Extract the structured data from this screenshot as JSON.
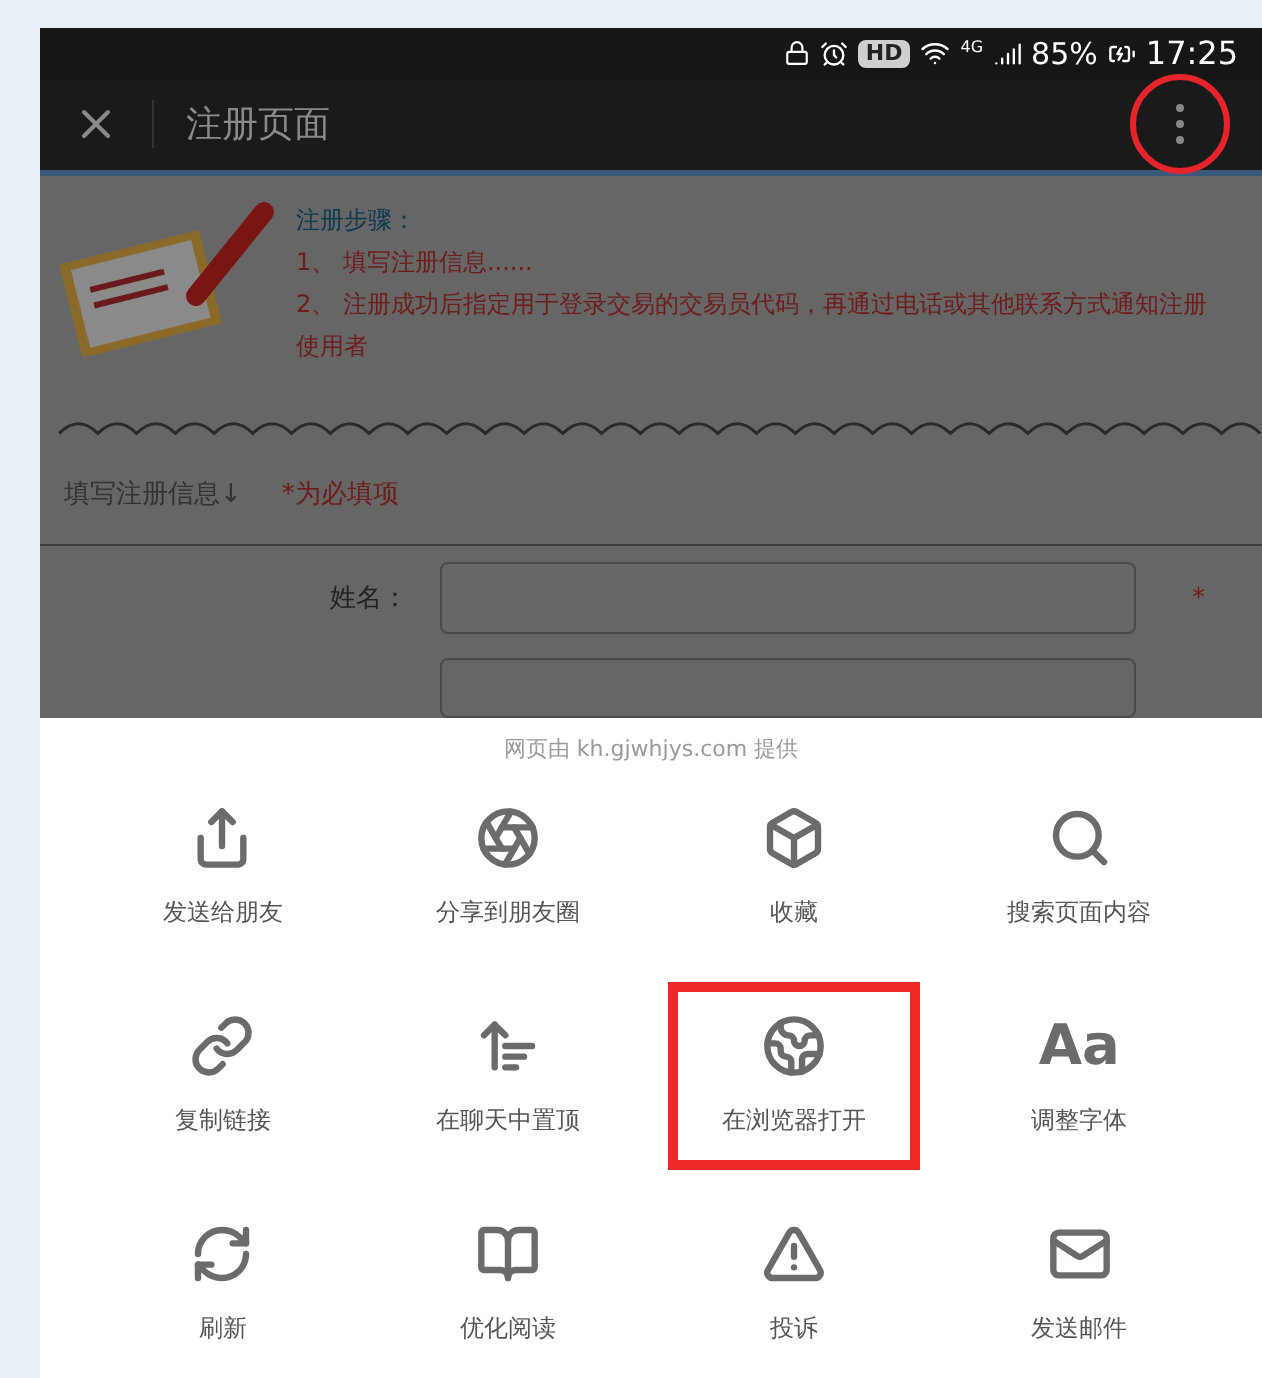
{
  "status_bar": {
    "hd": "HD",
    "network": "4G",
    "battery": "85%",
    "time": "17:25"
  },
  "title_bar": {
    "title": "注册页面",
    "menu_button": {
      "highlighted": true
    }
  },
  "page": {
    "steps_title": "注册步骤：",
    "steps": [
      "1、 填写注册信息......",
      "2、 注册成功后指定用于登录交易的交易员代码，再通过电话或其他联系方式通知注册使用者"
    ],
    "section_title": "填写注册信息↓",
    "required_note": "*为必填项",
    "fields": [
      {
        "label": "姓名：",
        "required_mark": "*"
      }
    ]
  },
  "sheet": {
    "provider": "网页由 kh.gjwhjys.com 提供",
    "items": [
      {
        "label": "发送给朋友",
        "highlighted": false
      },
      {
        "label": "分享到朋友圈",
        "highlighted": false
      },
      {
        "label": "收藏",
        "highlighted": false
      },
      {
        "label": "搜索页面内容",
        "highlighted": false
      },
      {
        "label": "复制链接",
        "highlighted": false
      },
      {
        "label": "在聊天中置顶",
        "highlighted": false
      },
      {
        "label": "在浏览器打开",
        "highlighted": true
      },
      {
        "label": "调整字体",
        "highlighted": false,
        "glyph": "Aa"
      },
      {
        "label": "刷新",
        "highlighted": false
      },
      {
        "label": "优化阅读",
        "highlighted": false
      },
      {
        "label": "投诉",
        "highlighted": false
      },
      {
        "label": "发送邮件",
        "highlighted": false
      }
    ]
  }
}
